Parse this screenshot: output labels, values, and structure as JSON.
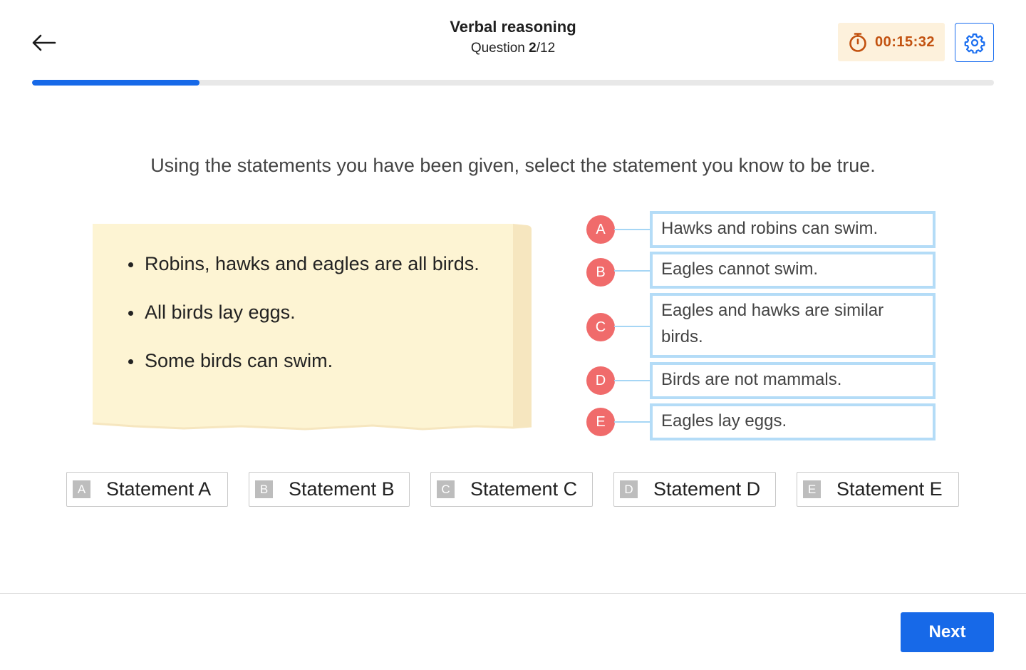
{
  "header": {
    "title": "Verbal reasoning",
    "question_prefix": "Question ",
    "question_current": "2",
    "question_total": "/12",
    "timer": "00:15:32",
    "back_icon": "arrow-left-icon",
    "timer_icon": "stopwatch-icon",
    "settings_icon": "gear-icon"
  },
  "progress": {
    "fraction": 0.174
  },
  "question": "Using the statements you have been given, select the statement you know to be true.",
  "statements": [
    "Robins, hawks and eagles are all birds.",
    "All birds lay eggs.",
    "Some birds can swim."
  ],
  "options": [
    {
      "letter": "A",
      "text": "Hawks and robins can swim."
    },
    {
      "letter": "B",
      "text": "Eagles cannot swim."
    },
    {
      "letter": "C",
      "text": "Eagles and hawks are similar birds."
    },
    {
      "letter": "D",
      "text": "Birds are not mammals."
    },
    {
      "letter": "E",
      "text": "Eagles lay eggs."
    }
  ],
  "answers": [
    {
      "letter": "A",
      "label": "Statement A"
    },
    {
      "letter": "B",
      "label": "Statement B"
    },
    {
      "letter": "C",
      "label": "Statement C"
    },
    {
      "letter": "D",
      "label": "Statement D"
    },
    {
      "letter": "E",
      "label": "Statement E"
    }
  ],
  "footer": {
    "next_label": "Next"
  },
  "colors": {
    "accent": "#1769e8",
    "marker": "#f06b6b",
    "option_border": "#b4dcf7",
    "timer_bg": "#fdf1dc",
    "timer_text": "#c2510f",
    "note_bg": "#fdf4d3"
  }
}
